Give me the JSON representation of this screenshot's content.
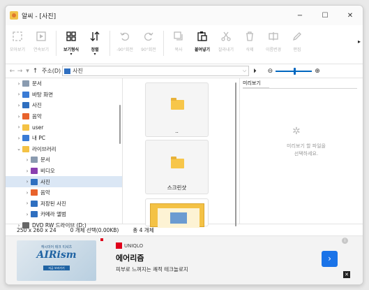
{
  "window": {
    "title": "알씨 - [사진]",
    "controls": {
      "minimize": "−",
      "maximize": "☐",
      "close": "✕"
    }
  },
  "toolbar": {
    "items": [
      {
        "label": "모아보기",
        "icon": "fullscreen-icon",
        "enabled": false
      },
      {
        "label": "연속보기",
        "icon": "play-icon",
        "enabled": false
      },
      {
        "label": "보기형식",
        "icon": "grid-icon",
        "enabled": true,
        "caret": "▾"
      },
      {
        "label": "정렬",
        "icon": "sort-icon",
        "enabled": true,
        "caret": "▾"
      },
      {
        "label": "-90°회전",
        "icon": "rotate-left-icon",
        "enabled": false
      },
      {
        "label": "90°회전",
        "icon": "rotate-right-icon",
        "enabled": false
      },
      {
        "label": "복사",
        "icon": "copy-icon",
        "enabled": false
      },
      {
        "label": "붙여넣기",
        "icon": "paste-icon",
        "enabled": true
      },
      {
        "label": "잘라내기",
        "icon": "cut-icon",
        "enabled": false
      },
      {
        "label": "삭제",
        "icon": "delete-icon",
        "enabled": false
      },
      {
        "label": "이름변경",
        "icon": "rename-icon",
        "enabled": false
      },
      {
        "label": "편집",
        "icon": "edit-icon",
        "enabled": false
      }
    ],
    "more": "▸"
  },
  "address": {
    "back": "←",
    "forward": "→",
    "recent": "▾",
    "up": "↑",
    "label": "주소(D)",
    "path": "사진",
    "dropdown": "⌵",
    "go": "⏵",
    "zoom_out": "⊖",
    "zoom_in": "⊕",
    "zoom_level": 0.5
  },
  "tree": {
    "items": [
      {
        "label": "문서",
        "chev": "›",
        "icon_color": "#8a9bb0",
        "indent": 0
      },
      {
        "label": "바탕 화면",
        "chev": "›",
        "icon_color": "#3a7bd5",
        "indent": 0
      },
      {
        "label": "사진",
        "chev": "›",
        "icon_color": "#2f6fc0",
        "indent": 0
      },
      {
        "label": "음악",
        "chev": "›",
        "icon_color": "#e8632c",
        "indent": 0
      },
      {
        "label": "user",
        "chev": "›",
        "icon_color": "#f4c245",
        "indent": 0
      },
      {
        "label": "내 PC",
        "chev": "›",
        "icon_color": "#3a7bd5",
        "indent": 0
      },
      {
        "label": "라이브러리",
        "chev": "⌄",
        "icon_color": "#f4c245",
        "indent": 0
      },
      {
        "label": "문서",
        "chev": "›",
        "icon_color": "#8a9bb0",
        "indent": 1
      },
      {
        "label": "비디오",
        "chev": "›",
        "icon_color": "#8a3fb0",
        "indent": 1
      },
      {
        "label": "사진",
        "chev": "›",
        "icon_color": "#2f6fc0",
        "indent": 1,
        "selected": true
      },
      {
        "label": "음악",
        "chev": "›",
        "icon_color": "#e8632c",
        "indent": 1
      },
      {
        "label": "저장된 사진",
        "chev": "›",
        "icon_color": "#2f6fc0",
        "indent": 1
      },
      {
        "label": "카메라 앨범",
        "chev": "›",
        "icon_color": "#2f6fc0",
        "indent": 1
      },
      {
        "label": "DVD RW 드라이브 (D:)",
        "chev": "›",
        "icon_color": "#666666",
        "indent": 0
      }
    ]
  },
  "files": {
    "tiles": [
      {
        "caption": ".."
      },
      {
        "caption": "스크린샷"
      },
      {
        "caption": ""
      }
    ]
  },
  "preview": {
    "tab": "미리보기",
    "message_line1": "미리보기 할 파일을",
    "message_line2": "선택하세요."
  },
  "status": {
    "size": "250 x 260 x 24",
    "selection": "0 개체 선택(0.00KB)",
    "total": "총 4 개체"
  },
  "ad": {
    "image_top": "캐시미어 테크 티셔츠",
    "image_brand": "AIRism",
    "image_badge": "지금 보러가기",
    "brand": "UNIQLO",
    "title": "에어리즘",
    "desc": "피부로 느껴지는 쾌적 테크놀로지",
    "cta": "›",
    "info": "i",
    "close": "✕"
  },
  "colors": {
    "accent": "#0067c0",
    "selection": "#dbe7f5",
    "folder": "#f7c64a"
  }
}
